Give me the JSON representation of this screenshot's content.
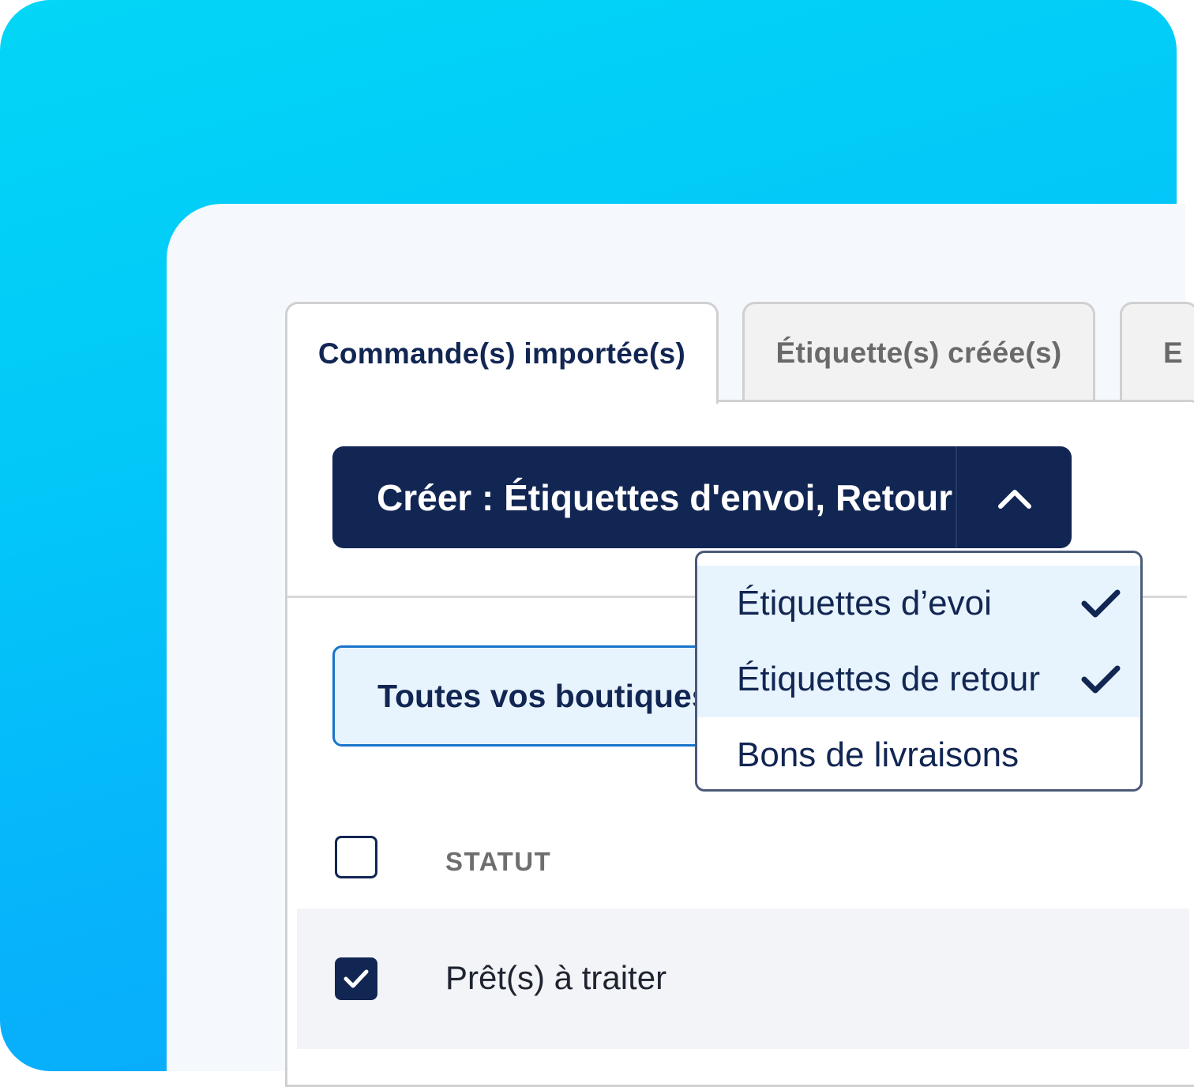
{
  "tabs": [
    {
      "label": "Commande(s) importée(s)",
      "active": true
    },
    {
      "label": "Étiquette(s) créée(s)",
      "active": false
    },
    {
      "label": "E",
      "active": false
    }
  ],
  "create_button": {
    "label": "Créer : Étiquettes d'envoi, Retour",
    "toggle_icon": "chevron-up-icon",
    "expanded": true
  },
  "shop_filter": {
    "value": "Toutes vos boutiques"
  },
  "create_menu": {
    "items": [
      {
        "label": "Étiquettes d’evoi",
        "checked": true
      },
      {
        "label": "Étiquettes de retour",
        "checked": true
      },
      {
        "label": "Bons de livraisons",
        "checked": false
      }
    ]
  },
  "table": {
    "columns": [
      "STATUT"
    ],
    "rows": [
      {
        "selected": true,
        "status": "Prêt(s) à traiter"
      }
    ]
  },
  "colors": {
    "brand_navy": "#122653",
    "accent_blue": "#1a74cc",
    "selection_bg": "#e8f4fd"
  }
}
